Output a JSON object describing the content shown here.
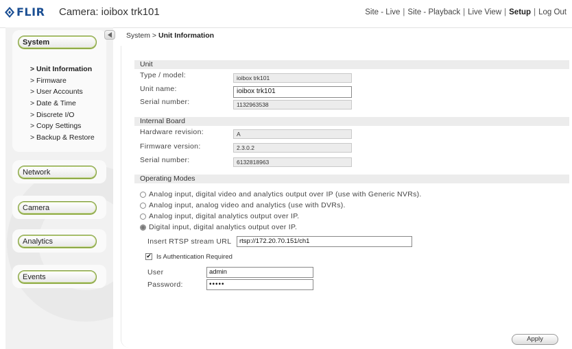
{
  "header": {
    "logo_text": "FLIR",
    "camera_title": "Camera: ioibox trk101",
    "nav": [
      {
        "label": "Site - Live",
        "bold": false
      },
      {
        "label": "Site - Playback",
        "bold": false
      },
      {
        "label": "Live View",
        "bold": false
      },
      {
        "label": "Setup",
        "bold": true
      },
      {
        "label": "Log Out",
        "bold": false
      }
    ],
    "separator": "|"
  },
  "sidebar": {
    "sections": [
      "System",
      "Network",
      "Camera",
      "Analytics",
      "Events"
    ],
    "active_section": "System",
    "system_items": [
      "> Unit Information",
      "> Firmware",
      "> User Accounts",
      "> Date & Time",
      "> Discrete I/O",
      "> Copy Settings",
      "> Backup & Restore"
    ],
    "active_item": "> Unit Information"
  },
  "breadcrumb": {
    "parent": "System >",
    "current": "Unit Information"
  },
  "unit": {
    "heading": "Unit",
    "type_label": "Type / model:",
    "type_value": "ioibox trk101",
    "name_label": "Unit name:",
    "name_value": "ioibox trk101",
    "serial_label": "Serial number:",
    "serial_value": "1132963538"
  },
  "board": {
    "heading": "Internal Board",
    "hw_label": "Hardware revision:",
    "hw_value": "A",
    "fw_label": "Firmware version:",
    "fw_value": "2.3.0.2",
    "serial_label": "Serial number:",
    "serial_value": "6132818963"
  },
  "modes": {
    "heading": "Operating Modes",
    "options": [
      "Analog input, digital video and analytics output over IP (use with Generic NVRs).",
      "Analog input, analog video and analytics (use with DVRs).",
      "Analog input, digital analytics output over IP.",
      "Digital input, digital analytics output over IP."
    ],
    "selected_index": 3,
    "rtsp_label": "Insert RTSP stream URL",
    "rtsp_value": "rtsp://172.20.70.151/ch1",
    "auth_label": "Is Authentication Required",
    "auth_checked": true,
    "user_label": "User",
    "user_value": "admin",
    "password_label": "Password:",
    "password_value": "•••••"
  },
  "apply_label": "Apply",
  "colors": {
    "brand": "#1b4f93",
    "button_border": "#7d9a3c",
    "panel": "#f1f1f1"
  }
}
